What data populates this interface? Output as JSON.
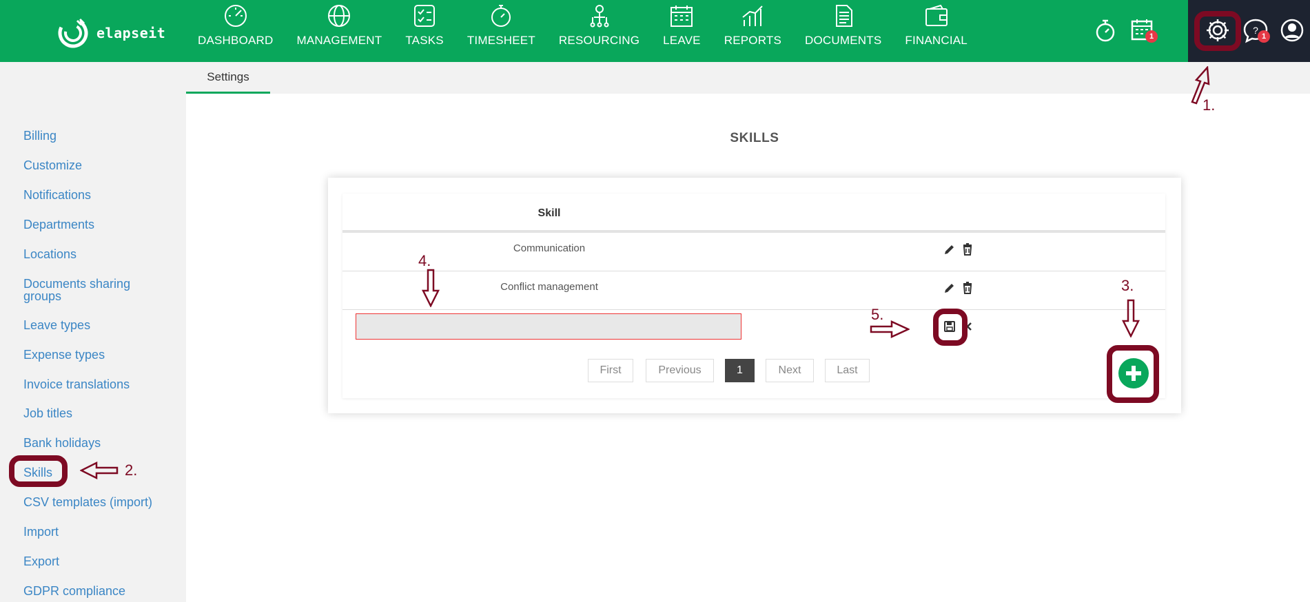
{
  "app": {
    "logo_text": "elapseit"
  },
  "nav": [
    {
      "label": "DASHBOARD",
      "icon": "dashboard-gauge-icon"
    },
    {
      "label": "MANAGEMENT",
      "icon": "globe-icon"
    },
    {
      "label": "TASKS",
      "icon": "task-list-icon"
    },
    {
      "label": "TIMESHEET",
      "icon": "stopwatch-icon"
    },
    {
      "label": "RESOURCING",
      "icon": "person-network-icon"
    },
    {
      "label": "LEAVE",
      "icon": "calendar-icon"
    },
    {
      "label": "REPORTS",
      "icon": "bar-chart-icon"
    },
    {
      "label": "DOCUMENTS",
      "icon": "document-icon"
    },
    {
      "label": "FINANCIAL",
      "icon": "wallet-icon"
    }
  ],
  "top_icons": {
    "calendar_badge": "1",
    "help_badge": "1"
  },
  "subheader": {
    "tab": "Settings"
  },
  "sidebar": [
    "Billing",
    "Customize",
    "Notifications",
    "Departments",
    "Locations",
    "Documents sharing groups",
    "Leave types",
    "Expense types",
    "Invoice translations",
    "Job titles",
    "Bank holidays",
    "Skills",
    "CSV templates (import)",
    "Import",
    "Export",
    "GDPR compliance"
  ],
  "page": {
    "title": "SKILLS",
    "table": {
      "header_skill": "Skill",
      "rows": [
        "Communication",
        "Conflict management"
      ]
    },
    "new_skill_value": "",
    "pagination": {
      "first": "First",
      "previous": "Previous",
      "current": "1",
      "next": "Next",
      "last": "Last"
    }
  },
  "annotations": {
    "step1": "1.",
    "step2": "2.",
    "step3": "3.",
    "step4": "4.",
    "step5": "5.",
    "color": "#7d0a23"
  },
  "colors": {
    "brand_green": "#09a75b",
    "dark_header": "#1d2330",
    "link_blue": "#3b86c5",
    "badge_red": "#e63946"
  }
}
